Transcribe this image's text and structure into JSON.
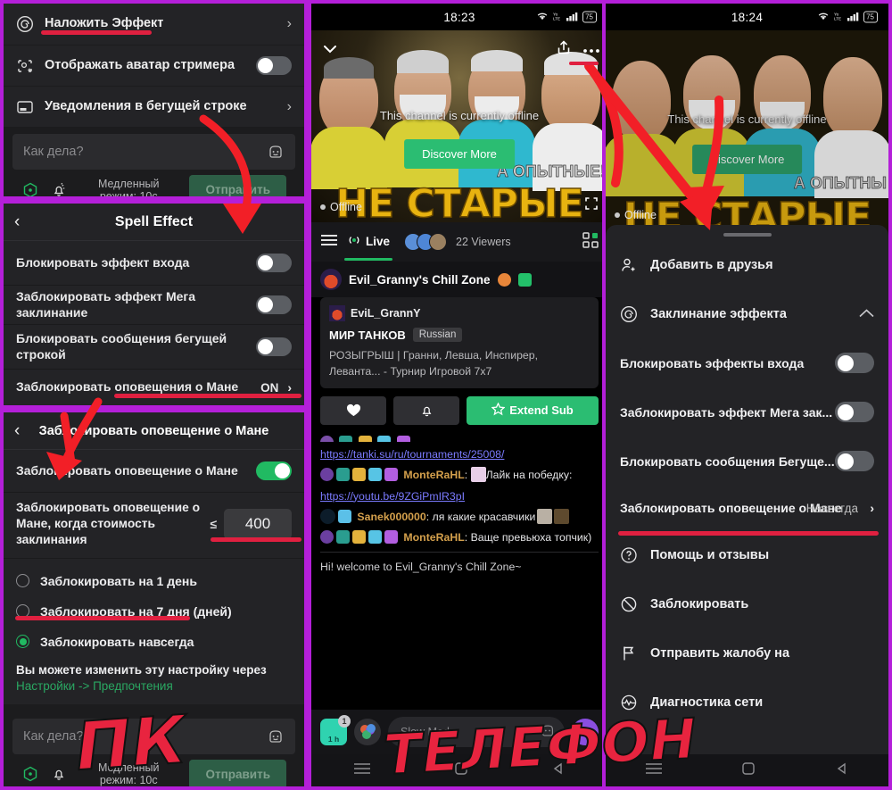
{
  "theme": {
    "frame_purple": "#b41fd9",
    "accent_green": "#21ba62",
    "annotation_red": "#e02040",
    "link_blue": "#7b7bff"
  },
  "pc": {
    "panel1": {
      "rows": [
        {
          "icon": "spiral-icon",
          "label": "Наложить Эффект",
          "trailing": "›",
          "underlined": true
        },
        {
          "icon": "avatar-sparkle-icon",
          "label": "Отображать аватар стримера",
          "toggle": "off"
        },
        {
          "icon": "ticker-icon",
          "label": "Уведомления в бегущей строке",
          "trailing": "›"
        }
      ],
      "composer": {
        "placeholder": "Как дела?",
        "emoji_icon": "emoji-icon",
        "points_icon": "channel-points-icon",
        "bell_icon": "bell-icon",
        "slow_mode": "Медленный режим: 10с",
        "send_label": "Отправить"
      }
    },
    "panel2": {
      "title": "Spell Effect",
      "back_icon": "back-chevron-icon",
      "rows": [
        {
          "label": "Блокировать эффект входа",
          "toggle": "off"
        },
        {
          "label": "Заблокировать эффект Мега заклинание",
          "toggle": "off"
        },
        {
          "label": "Блокировать сообщения бегущей строкой",
          "toggle": "off"
        },
        {
          "label": "Заблокировать оповещения о Мане",
          "value": "ON",
          "trailing": "›",
          "underlined": true
        }
      ]
    },
    "panel3": {
      "title": "Заблокировать оповещение о Мане",
      "back_icon": "back-chevron-icon",
      "main_toggle": {
        "label": "Заблокировать оповещение о Мане",
        "toggle": "on"
      },
      "threshold": {
        "label": "Заблокировать оповещение о Мане, когда стоимость заклинания",
        "operator": "≤",
        "value": "400"
      },
      "options": [
        {
          "label": "Заблокировать на 1 день",
          "selected": false
        },
        {
          "label": "Заблокировать на 7 дня (дней)",
          "selected": false
        },
        {
          "label": "Заблокировать навсегда",
          "selected": true,
          "underlined": true
        }
      ],
      "note_line1": "Вы можете изменить эту настройку через",
      "note_line2": "Настройки -> Предпочтения",
      "composer": {
        "placeholder": "Как дела?",
        "slow_mode": "Медленный режим: 10с",
        "send_label": "Отправить"
      }
    }
  },
  "phone_mid": {
    "status": {
      "time": "18:23",
      "wifi_icon": "wifi-icon",
      "volte_icon": "volte-icon",
      "signal_icon": "signal-icon",
      "battery": "75"
    },
    "player": {
      "collapse_icon": "chevron-down-icon",
      "share_icon": "share-icon",
      "more_icon": "more-dots-icon",
      "offline_text": "This channel is currently offline",
      "discover_label": "Discover More",
      "status_label": "Offline",
      "fullscreen_icon": "fullscreen-icon",
      "thumb_title": "НЕ СТАРЫЕ",
      "thumb_subtitle": "А ОПЫТНЫЕ!"
    },
    "tabbar": {
      "menu_icon": "hamburger-icon",
      "live_label": "Live",
      "live_icon": "broadcast-icon",
      "viewers": "22 Viewers",
      "grid_icon": "grid-icon"
    },
    "channel": {
      "name": "Evil_Granny's Chill Zone",
      "avatar_icon": "channel-avatar-icon"
    },
    "info": {
      "username": "EviL_GrannY",
      "category": "МИР ТАНКОВ",
      "language_tag": "Russian",
      "description": "РОЗЫГРЫШ | Гранни, Левша, Инспирер, Леванта... - Турнир Игровой 7х7"
    },
    "buttons": {
      "heart_icon": "heart-icon",
      "bell_icon": "bell-icon",
      "extend_label": "Extend Sub",
      "star_icon": "star-icon"
    },
    "chat": [
      {
        "type": "link",
        "text": "https://tanki.su/ru/tournaments/25008/"
      },
      {
        "type": "message",
        "user": "MonteRaHL",
        "text": "Лайк на победку:"
      },
      {
        "type": "link",
        "text": "https://youtu.be/9ZGiPmIR3pI"
      },
      {
        "type": "message",
        "user": "Sanek000000",
        "text": "ля какие красавчики"
      },
      {
        "type": "message",
        "user": "MonteRaHL",
        "text": "Ваще превьюха топчик)"
      }
    ],
    "welcome": "Hi! welcome to Evil_Granny's Chill Zone~",
    "bottom": {
      "cube_label": "1 h",
      "cube_count": "1",
      "palette_icon": "palette-icon",
      "chat_placeholder": "Slow Mode",
      "emoji_icon": "emoji-icon",
      "avatar_icon": "user-avatar-icon"
    },
    "nav": {
      "menu_icon": "nav-menu-icon",
      "home_icon": "nav-home-icon",
      "back_icon": "nav-back-icon"
    }
  },
  "phone_right": {
    "status": {
      "time": "18:24",
      "battery": "75"
    },
    "player": {
      "offline_text": "This channel is currently offline",
      "discover_label": "Discover More",
      "status_label": "Offline",
      "thumb_title": "НЕ СТАРЫЕ",
      "thumb_subtitle": "А ОПЫТНЫ"
    },
    "menu": {
      "add_friend": {
        "icon": "add-friend-icon",
        "label": "Добавить в друзья"
      },
      "spell_section": {
        "icon": "spiral-icon",
        "label": "Заклинание эффекта",
        "expanded": true,
        "chev": "chevron-up-icon"
      },
      "toggles": [
        {
          "label": "Блокировать эффекты входа",
          "toggle": "off"
        },
        {
          "label": "Заблокировать эффект Мега зак...",
          "toggle": "off"
        },
        {
          "label": "Блокировать сообщения Бегуще...",
          "toggle": "off"
        }
      ],
      "mane_row": {
        "label": "Заблокировать оповещение о Мане",
        "value": "Навсегда",
        "trailing": "›",
        "underlined": true
      },
      "items": [
        {
          "icon": "help-icon",
          "label": "Помощь и отзывы"
        },
        {
          "icon": "block-icon",
          "label": "Заблокировать"
        },
        {
          "icon": "flag-icon",
          "label": "Отправить жалобу на"
        },
        {
          "icon": "network-diagnostics-icon",
          "label": "Диагностика сети"
        }
      ]
    }
  },
  "watermarks": [
    {
      "text": "ПК",
      "where": "left-bottom"
    },
    {
      "text": "ТЕЛЕФОН",
      "where": "right-bottom"
    }
  ]
}
